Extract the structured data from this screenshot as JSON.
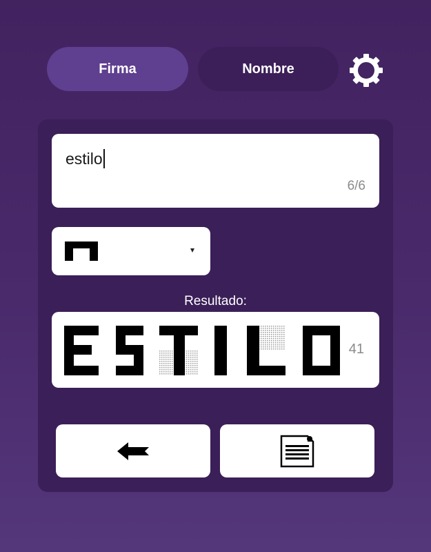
{
  "tabs": {
    "firma_label": "Firma",
    "nombre_label": "Nombre",
    "active": "Firma"
  },
  "settings_icon": "gear-icon",
  "input": {
    "value": "estilo",
    "counter": "6/6"
  },
  "style_select": {
    "selected_preview": "block-arch-style-sample",
    "arrow_icon": "dropdown-triangle-icon"
  },
  "result": {
    "label": "Resultado:",
    "text_rendered": "ESTILO",
    "count": "41"
  },
  "actions": {
    "back_icon": "arrow-left-icon",
    "document_icon": "document-icon"
  },
  "colors": {
    "background": "#4a2a6b",
    "panel": "#3b1f58",
    "tab_active": "#5f3f8f",
    "tab_inactive": "#3c1f59",
    "surface": "#ffffff"
  }
}
